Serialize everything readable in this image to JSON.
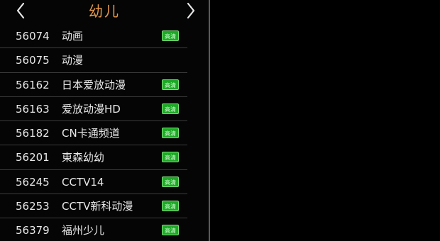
{
  "header": {
    "title": "幼儿",
    "prev_icon": "chevron-left-icon",
    "next_icon": "chevron-right-icon"
  },
  "channels": [
    {
      "number": "56074",
      "name": "动画",
      "badge": "高清"
    },
    {
      "number": "56075",
      "name": "动漫",
      "badge": ""
    },
    {
      "number": "56162",
      "name": "日本爱放动漫",
      "badge": "高清"
    },
    {
      "number": "56163",
      "name": "爱放动漫HD",
      "badge": "高清"
    },
    {
      "number": "56182",
      "name": "CN卡通频道",
      "badge": "高清"
    },
    {
      "number": "56201",
      "name": "東森幼幼",
      "badge": "高清"
    },
    {
      "number": "56245",
      "name": "CCTV14",
      "badge": "高清"
    },
    {
      "number": "56253",
      "name": "CCTV新科动漫",
      "badge": "高清"
    },
    {
      "number": "56379",
      "name": "福州少儿",
      "badge": "高清"
    }
  ],
  "colors": {
    "title": "#e89a4c",
    "badge_bg": "#1ea827",
    "text": "#e8e8e8",
    "background": "#000000"
  }
}
